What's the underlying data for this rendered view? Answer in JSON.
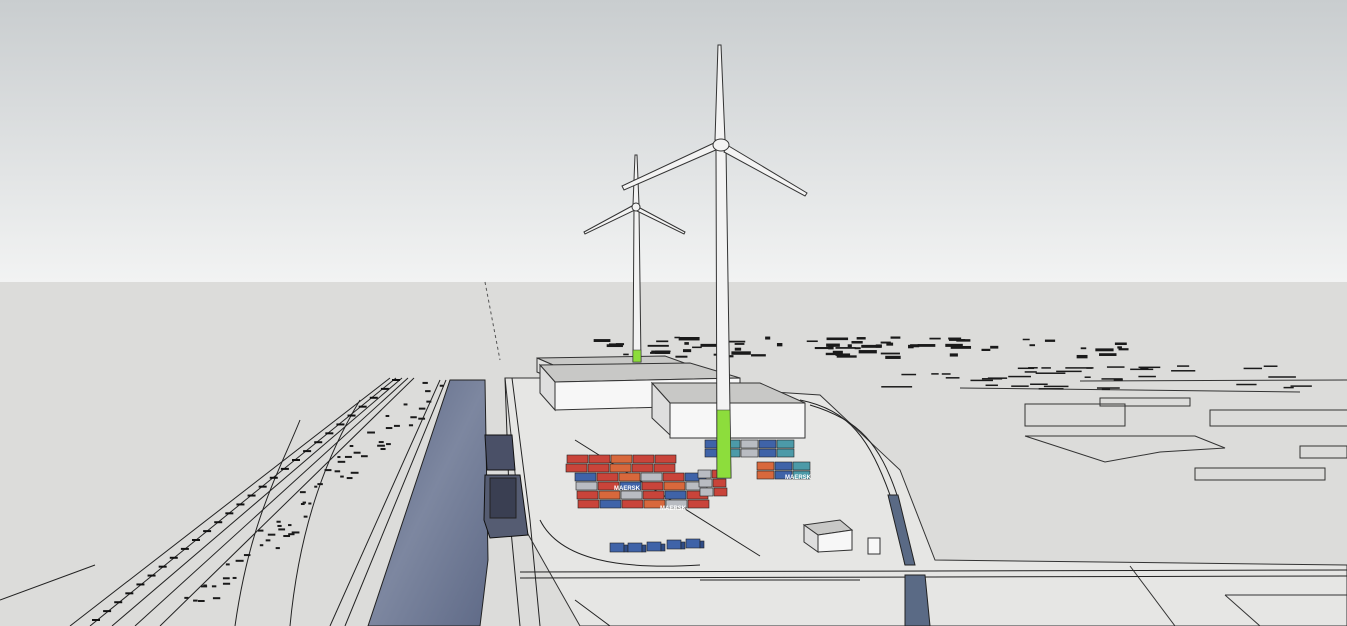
{
  "scene": {
    "description_free": true,
    "colors": {
      "sky_top": "#c9cdcf",
      "sky_bottom": "#f2f3f3",
      "ground": "#dcdcda",
      "water": "#6f7a93",
      "building_front": "#f7f7f7",
      "building_top": "#c8c8c6",
      "turbine": "#f3f3f3",
      "turbine_base": "#8ddd3c",
      "line": "#2a2a2a",
      "container_red": "#c9443a",
      "container_orange": "#d8683c",
      "container_blue": "#3f63a8",
      "container_grey": "#b9bcc2",
      "container_teal": "#4c9aa8"
    },
    "container_labels": [
      "MAERSK",
      "MAERSK",
      "MAERSK"
    ],
    "icons": [
      "wind-turbine-icon",
      "cargo-ship-icon",
      "warehouse-icon",
      "truck-icon"
    ]
  }
}
